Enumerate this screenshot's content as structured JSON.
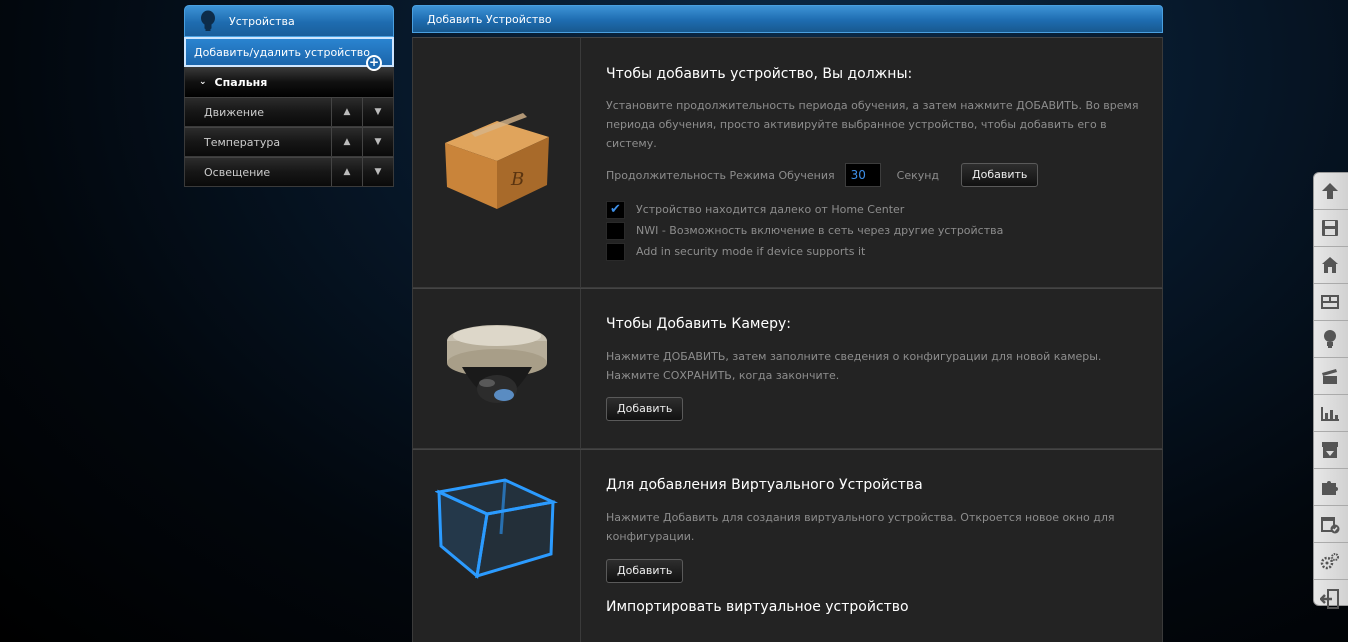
{
  "sidebar": {
    "header_label": "Устройства",
    "add_remove_label": "Добавить/удалить устройство",
    "room_label": "Спальня",
    "items": [
      {
        "label": "Движение"
      },
      {
        "label": "Температура"
      },
      {
        "label": "Освещение"
      }
    ]
  },
  "panel": {
    "title": "Добавить Устройство",
    "add_device": {
      "heading": "Чтобы добавить устройство, Вы должны:",
      "description": "Установите продолжительность периода обучения, а затем нажмите ДОБАВИТЬ. Во время периода обучения, просто активируйте выбранное устройство, чтобы добавить его в систему.",
      "duration_label": "Продолжительность Режима Обучения",
      "duration_value": "30",
      "seconds_label": "Секунд",
      "add_button": "Добавить",
      "options": [
        {
          "label": "Устройство находится далеко от Home Center",
          "checked": true
        },
        {
          "label": "NWI - Возможность включение в сеть через другие устройства",
          "checked": false
        },
        {
          "label": "Add in security mode if device supports it",
          "checked": false
        }
      ]
    },
    "add_camera": {
      "heading": "Чтобы Добавить Камеру:",
      "description": "Нажмите ДОБАВИТЬ, затем заполните сведения о конфигурации для новой камеры. Нажмите СОХРАНИТЬ, когда закончите.",
      "add_button": "Добавить"
    },
    "add_virtual": {
      "heading": "Для добавления Виртуального Устройства",
      "description": "Нажмите Добавить для создания виртуального устройства. Откроется новое окно для конфигурации.",
      "add_button": "Добавить",
      "import_heading": "Импортировать виртуальное устройство"
    }
  },
  "toolbar": {
    "icons": [
      "upload-icon",
      "save-icon",
      "home-icon",
      "rooms-icon",
      "bulb-icon",
      "scenes-icon",
      "panels-icon",
      "backup-icon",
      "plugins-icon",
      "schedule-icon",
      "settings-icon",
      "logout-icon"
    ]
  },
  "colors": {
    "accent": "#1e6cb0",
    "input_text": "#3d8fe8",
    "panel_bg": "#232323"
  }
}
